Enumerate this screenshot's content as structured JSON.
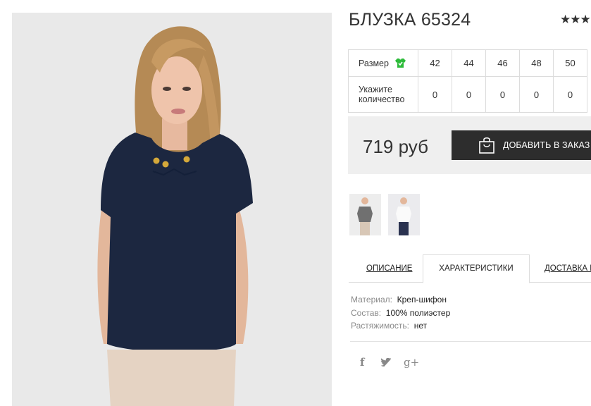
{
  "product": {
    "title": "БЛУЗКА 65324",
    "rating_stars": "★★★",
    "price": "719 руб",
    "add_to_order_label": "ДОБАВИТЬ В ЗАКАЗ"
  },
  "size_table": {
    "size_label": "Размер",
    "quantity_label": "Укажите количество",
    "sizes": [
      "42",
      "44",
      "46",
      "48",
      "50"
    ],
    "quantities": [
      "0",
      "0",
      "0",
      "0",
      "0"
    ]
  },
  "tabs": [
    {
      "label": "ОПИСАНИЕ",
      "active": false
    },
    {
      "label": "ХАРАКТЕРИСТИКИ",
      "active": true
    },
    {
      "label": "ДОСТАВКА И"
    }
  ],
  "characteristics": [
    {
      "key": "Материал:",
      "value": "Креп-шифон"
    },
    {
      "key": "Состав:",
      "value": "100% полиэстер"
    },
    {
      "key": "Растяжимость:",
      "value": "нет"
    }
  ],
  "social": {
    "facebook": "f",
    "twitter": "🐦",
    "googleplus": "g+"
  },
  "colors": {
    "button_bg": "#2d2d2d",
    "price_bg": "#efefef",
    "size_icon": "#2dbb3a",
    "blouse": "#1c2740"
  },
  "icons": {
    "size_guide": "shirt-icon",
    "add_button": "shopping-bag-icon",
    "social": [
      "facebook-icon",
      "twitter-icon",
      "google-plus-icon"
    ]
  }
}
